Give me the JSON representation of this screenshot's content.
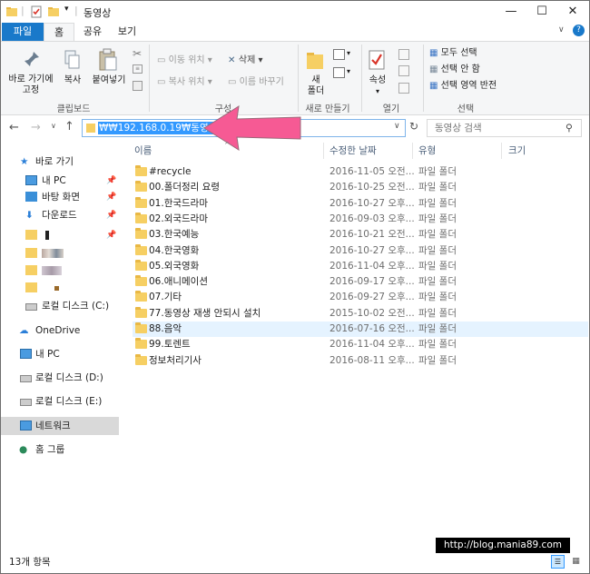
{
  "window": {
    "title": "동영상"
  },
  "tabs": [
    {
      "label": "파일"
    },
    {
      "label": "홈"
    },
    {
      "label": "공유"
    },
    {
      "label": "보기"
    }
  ],
  "ribbon": {
    "clipboard": {
      "pin_label": "바로 가기에\n고정",
      "pin_label_1": "바로 가기에",
      "pin_label_2": "고정",
      "copy": "복사",
      "paste": "붙여넣기",
      "group": "클립보드"
    },
    "organize": {
      "move_to": "이동 위치",
      "copy_to": "복사 위치",
      "delete": "삭제",
      "rename": "이름 바꾸기",
      "group": "구성"
    },
    "new": {
      "new_folder_1": "새",
      "new_folder_2": "폴더",
      "group": "새로 만들기"
    },
    "open": {
      "properties": "속성",
      "group": "열기"
    },
    "select": {
      "select_all": "모두 선택",
      "select_none": "선택 안 함",
      "invert": "선택 영역 반전",
      "group": "선택"
    }
  },
  "address": {
    "path": "₩₩192.168.0.19₩동영상",
    "search_placeholder": "동영상 검색"
  },
  "sidebar": {
    "quick_access": "바로 가기",
    "pinned": [
      {
        "label": "내 PC"
      },
      {
        "label": "바탕 화면"
      },
      {
        "label": "다운로드"
      }
    ],
    "local_disk_c": "로컬 디스크 (C:)",
    "onedrive": "OneDrive",
    "this_pc": "내 PC",
    "disk_d": "로컬 디스크 (D:)",
    "disk_e": "로컬 디스크 (E:)",
    "network": "네트워크",
    "homegroup": "홈 그룹"
  },
  "columns": {
    "name": "이름",
    "date": "수정한 날짜",
    "type": "유형",
    "size": "크기"
  },
  "files": [
    {
      "name": "#recycle",
      "date": "2016-11-05 오전...",
      "type": "파일 폴더"
    },
    {
      "name": "00.폴더정리 요령",
      "date": "2016-10-25 오전...",
      "type": "파일 폴더"
    },
    {
      "name": "01.한국드라마",
      "date": "2016-10-27 오후...",
      "type": "파일 폴더"
    },
    {
      "name": "02.외국드라마",
      "date": "2016-09-03 오후...",
      "type": "파일 폴더"
    },
    {
      "name": "03.한국예능",
      "date": "2016-10-21 오전...",
      "type": "파일 폴더"
    },
    {
      "name": "04.한국영화",
      "date": "2016-10-27 오후...",
      "type": "파일 폴더"
    },
    {
      "name": "05.외국영화",
      "date": "2016-11-04 오후...",
      "type": "파일 폴더"
    },
    {
      "name": "06.애니메이션",
      "date": "2016-09-17 오후...",
      "type": "파일 폴더"
    },
    {
      "name": "07.기타",
      "date": "2016-09-27 오후...",
      "type": "파일 폴더"
    },
    {
      "name": "77.동영상 재생 안되시 설치",
      "date": "2015-10-02 오전...",
      "type": "파일 폴더"
    },
    {
      "name": "88.음악",
      "date": "2016-07-16 오전...",
      "type": "파일 폴더"
    },
    {
      "name": "99.토렌트",
      "date": "2016-11-04 오후...",
      "type": "파일 폴더"
    },
    {
      "name": "정보처리기사",
      "date": "2016-08-11 오후...",
      "type": "파일 폴더"
    }
  ],
  "status": {
    "count": "13개 항목"
  },
  "watermark": "http://blog.mania89.com",
  "colors": {
    "accent": "#1979ca",
    "arrow": "#f65a94",
    "folder": "#f6cf63",
    "selection": "#3399ff"
  }
}
